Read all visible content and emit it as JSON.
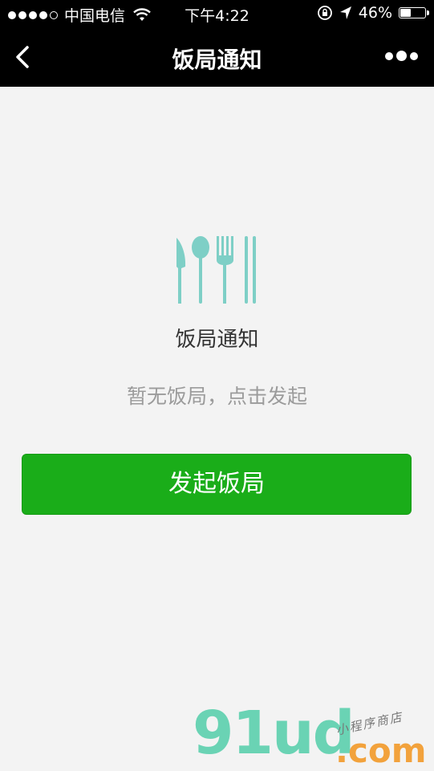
{
  "status_bar": {
    "carrier": "中国电信",
    "time": "下午4:22",
    "battery_percent_label": "46%",
    "battery_level": 0.46,
    "icons": [
      "signal-dots-icon",
      "wifi-icon",
      "rotation-lock-icon",
      "location-arrow-icon",
      "battery-icon"
    ]
  },
  "nav": {
    "title": "饭局通知",
    "back_icon": "chevron-left-icon",
    "more_icon": "more-dots-icon"
  },
  "empty_state": {
    "icon": "cutlery-icon",
    "title": "饭局通知",
    "subtitle": "暂无饭局，点击发起"
  },
  "actions": {
    "start_button": "发起饭局"
  },
  "watermark": {
    "logo": "91ud",
    "domain": ".com",
    "tagline": "小程序商店"
  },
  "colors": {
    "primary": "#1aad19",
    "icon_teal": "#7ecfc6",
    "background": "#f3f3f3",
    "bar": "#000000"
  }
}
